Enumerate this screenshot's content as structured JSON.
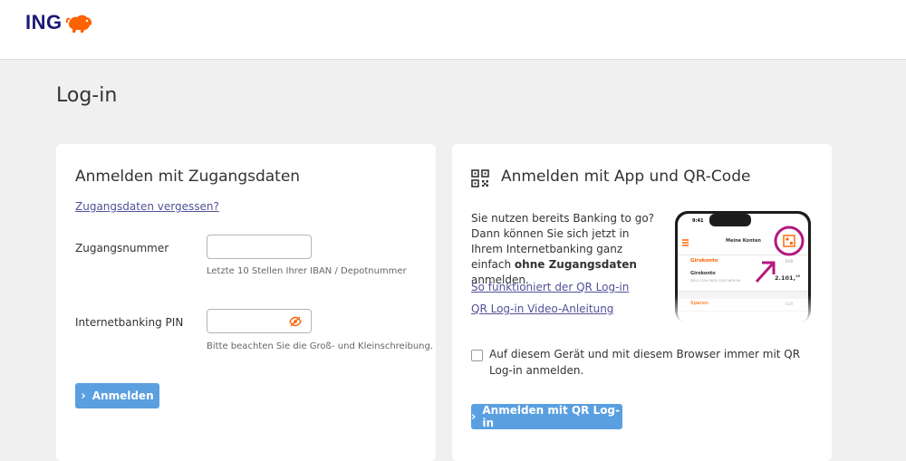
{
  "brand": {
    "name": "ING",
    "accent": "#ff6200",
    "navy": "#1d1a74"
  },
  "page": {
    "title": "Log-in"
  },
  "credentials_card": {
    "title": "Anmelden mit Zugangsdaten",
    "forgot_link": "Zugangsdaten vergessen?",
    "access_number": {
      "label": "Zugangsnummer",
      "value": "",
      "hint": "Letzte 10 Stellen Ihrer IBAN / Depotnummer"
    },
    "pin": {
      "label": "Internetbanking PIN",
      "value": "",
      "hint": "Bitte beachten Sie die Groß- und Kleinschreibung.",
      "toggle_icon": "eye-off-icon"
    },
    "submit_label": "Anmelden"
  },
  "qr_card": {
    "title": "Anmelden mit App und QR-Code",
    "icon": "qr-code-icon",
    "description_prefix": "Sie nutzen bereits Banking to go? Dann können Sie sich jetzt in Ihrem Internetbanking ganz einfach ",
    "description_bold": "ohne Zugangsdaten",
    "description_suffix": " anmelden.",
    "how_it_works_link": "So funktioniert der QR Log-in",
    "video_link": "QR Log-in Video-Anleitung",
    "remember_checkbox": {
      "checked": false,
      "label": "Auf diesem Gerät und mit diesem Browser immer mit QR Log-in anmelden."
    },
    "submit_label": "Anmelden mit QR Log-in",
    "phone_preview": {
      "time": "9:41",
      "header": "Meine Konten",
      "section1": "Girokonto",
      "section1_currency": "EUR",
      "account_name": "Girokonto",
      "account_iban": "DE12 1234 5678 1234 5678 90",
      "account_balance": "2.101,",
      "account_balance_cents": "10",
      "section2": "Sparen",
      "section2_currency": "EUR",
      "highlight_color": "#b5187f"
    }
  },
  "colors": {
    "button": "#5a9fe0",
    "link": "#525199"
  }
}
